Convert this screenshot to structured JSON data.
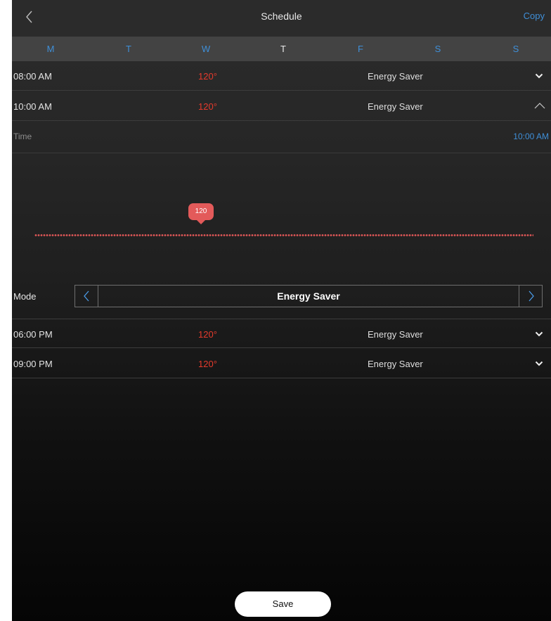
{
  "header": {
    "title": "Schedule",
    "copy_label": "Copy"
  },
  "days": [
    {
      "label": "M",
      "color": "#3f8fd8"
    },
    {
      "label": "T",
      "color": "#3f8fd8"
    },
    {
      "label": "W",
      "color": "#3f8fd8"
    },
    {
      "label": "T",
      "color": "#e8e8e8"
    },
    {
      "label": "F",
      "color": "#3f8fd8"
    },
    {
      "label": "S",
      "color": "#3f8fd8"
    },
    {
      "label": "S",
      "color": "#3f8fd8"
    }
  ],
  "schedule": [
    {
      "time": "08:00 AM",
      "temp": "120°",
      "mode": "Energy Saver",
      "expanded": false
    },
    {
      "time": "10:00 AM",
      "temp": "120°",
      "mode": "Energy Saver",
      "expanded": true
    },
    {
      "time": "06:00 PM",
      "temp": "120°",
      "mode": "Energy Saver",
      "expanded": false
    },
    {
      "time": "09:00 PM",
      "temp": "120°",
      "mode": "Energy Saver",
      "expanded": false
    }
  ],
  "editor": {
    "time_label": "Time",
    "time_value": "10:00 AM",
    "slider_value": "120",
    "mode_label": "Mode",
    "mode_value": "Energy Saver"
  },
  "save_label": "Save",
  "colors": {
    "accent_blue": "#3f8fd8",
    "temp_red": "#e53a2c",
    "slider_red": "#e35a5a"
  },
  "icons": {
    "back": "chevron-left-icon",
    "row_collapsed": "chevron-down-icon",
    "row_expanded": "chevron-up-icon",
    "mode_prev": "chevron-left-icon",
    "mode_next": "chevron-right-icon"
  }
}
